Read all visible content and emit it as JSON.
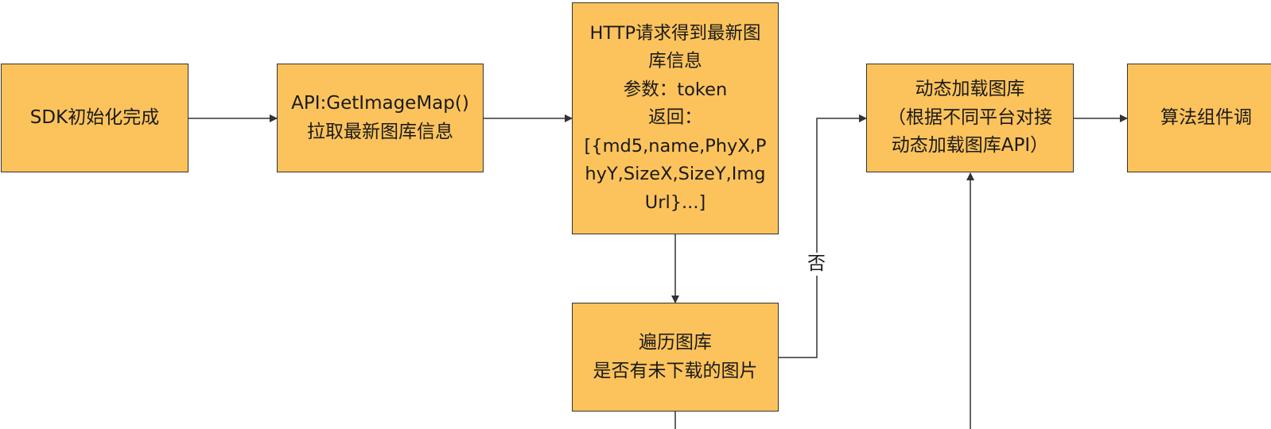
{
  "colors": {
    "node_fill": "#fcc35c",
    "node_border": "#333333",
    "edge": "#333333",
    "background": "#ffffff"
  },
  "nodes": [
    {
      "id": "sdk_init",
      "lines": [
        "SDK初始化完成"
      ]
    },
    {
      "id": "api_get_image_map",
      "lines": [
        "API:GetImageMap()",
        "拉取最新图库信息"
      ]
    },
    {
      "id": "http_request",
      "lines": [
        "HTTP请求得到最新图",
        "库信息",
        "参数：token",
        "返回：",
        "[{md5,name,PhyX,P",
        "hyY,SizeX,SizeY,Img",
        "Url}...]"
      ]
    },
    {
      "id": "iterate_gallery",
      "lines": [
        "遍历图库",
        "是否有未下载的图片"
      ]
    },
    {
      "id": "dynamic_load",
      "lines": [
        "动态加载图库",
        "（根据不同平台对接",
        "动态加载图库API）"
      ]
    },
    {
      "id": "algorithm_component",
      "lines": [
        "算法组件调"
      ]
    }
  ],
  "edges": [
    {
      "from": "sdk_init",
      "to": "api_get_image_map",
      "label": ""
    },
    {
      "from": "api_get_image_map",
      "to": "http_request",
      "label": ""
    },
    {
      "from": "http_request",
      "to": "iterate_gallery",
      "label": ""
    },
    {
      "from": "iterate_gallery",
      "to": "dynamic_load",
      "label": "否"
    },
    {
      "from": "dynamic_load",
      "to": "algorithm_component",
      "label": ""
    }
  ]
}
